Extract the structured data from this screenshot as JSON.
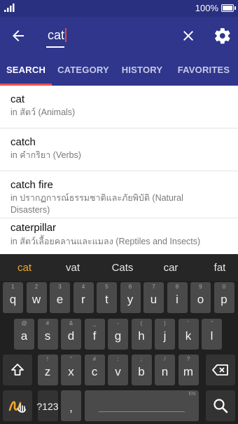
{
  "status_bar": {
    "battery_text": "100%"
  },
  "toolbar": {
    "query": "cat",
    "icons": [
      "back-arrow-icon",
      "close-icon",
      "gear-icon"
    ]
  },
  "tabs": [
    {
      "label": "SEARCH",
      "active": true
    },
    {
      "label": "CATEGORY",
      "active": false
    },
    {
      "label": "HISTORY",
      "active": false
    },
    {
      "label": "FAVORITES",
      "active": false
    }
  ],
  "results": [
    {
      "word": "cat",
      "category": "in สัตว์ (Animals)"
    },
    {
      "word": "catch",
      "category": "in คำกริยา (Verbs)"
    },
    {
      "word": "catch fire",
      "category": "in ปรากฏการณ์ธรรมชาติและภัยพิบัติ (Natural Disasters)"
    },
    {
      "word": "caterpillar",
      "category": "in สัตว์เลื้อยคลานและแมลง (Reptiles and Insects)"
    }
  ],
  "keyboard": {
    "suggestions": [
      "cat",
      "vat",
      "Cats",
      "car",
      "fat"
    ],
    "row1": [
      {
        "main": "q",
        "hint": "1"
      },
      {
        "main": "w",
        "hint": "2"
      },
      {
        "main": "e",
        "hint": "3"
      },
      {
        "main": "r",
        "hint": "4"
      },
      {
        "main": "t",
        "hint": "5"
      },
      {
        "main": "y",
        "hint": "6"
      },
      {
        "main": "u",
        "hint": "7"
      },
      {
        "main": "i",
        "hint": "8"
      },
      {
        "main": "o",
        "hint": "9"
      },
      {
        "main": "p",
        "hint": "0"
      }
    ],
    "row2": [
      {
        "main": "a",
        "hint": "@"
      },
      {
        "main": "s",
        "hint": "#"
      },
      {
        "main": "d",
        "hint": "&"
      },
      {
        "main": "f",
        "hint": "_"
      },
      {
        "main": "g",
        "hint": "-"
      },
      {
        "main": "h",
        "hint": "("
      },
      {
        "main": "j",
        "hint": ")"
      },
      {
        "main": "k",
        "hint": "'"
      },
      {
        "main": "l",
        "hint": "\""
      }
    ],
    "row3": [
      {
        "main": "z",
        "hint": "!"
      },
      {
        "main": "x",
        "hint": "\""
      },
      {
        "main": "c",
        "hint": "#"
      },
      {
        "main": "v",
        "hint": ":"
      },
      {
        "main": "b",
        "hint": ";"
      },
      {
        "main": "n",
        "hint": "/"
      },
      {
        "main": "m",
        "hint": "?"
      }
    ],
    "symbols_label": "?123",
    "comma": ",",
    "period": ".",
    "space_lang": "EN",
    "accent_color": "#f0a92b"
  }
}
